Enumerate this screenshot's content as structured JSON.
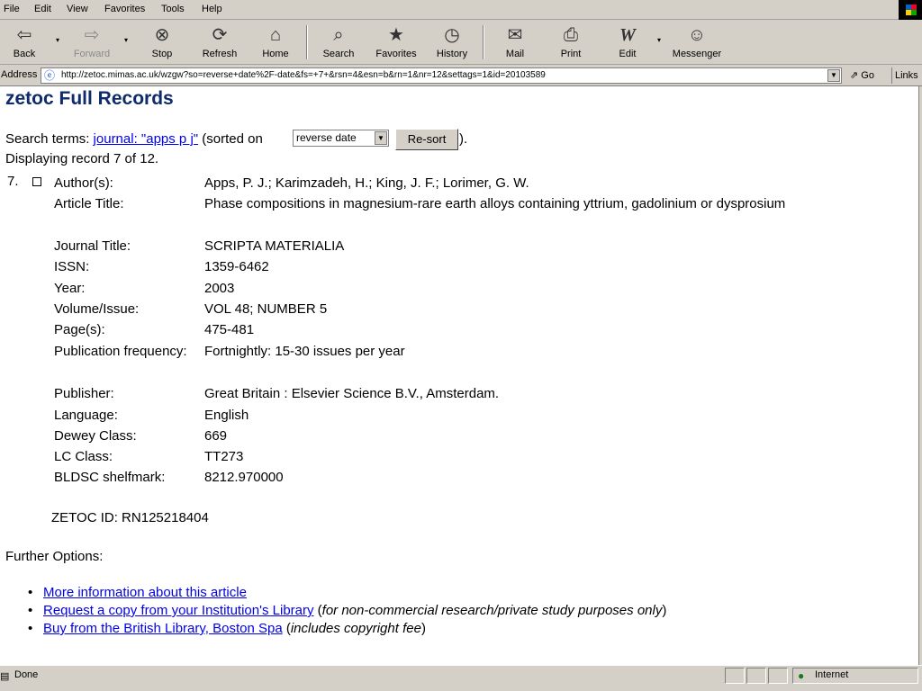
{
  "menu": [
    "File",
    "Edit",
    "View",
    "Favorites",
    "Tools",
    "Help"
  ],
  "toolbar": {
    "back": "Back",
    "forward": "Forward",
    "stop": "Stop",
    "refresh": "Refresh",
    "home": "Home",
    "search": "Search",
    "favorites": "Favorites",
    "history": "History",
    "mail": "Mail",
    "print": "Print",
    "edit": "Edit",
    "messenger": "Messenger"
  },
  "address": {
    "label": "Address",
    "url": "http://zetoc.mimas.ac.uk/wzgw?so=reverse+date%2F-date&fs=+7+&rsn=4&esn=b&rn=1&nr=12&settags=1&id=20103589",
    "go": "Go",
    "links": "Links"
  },
  "page": {
    "title": "zetoc Full Records",
    "search_prefix": "Search terms:",
    "search_link": "journal: \"apps p j\"",
    "sorted_on": "(sorted on",
    "sort_value": "reverse date",
    "resort": "Re-sort",
    "after_sort": ").",
    "displaying": "Displaying record 7 of 12."
  },
  "record": {
    "number": "7.",
    "fields": [
      {
        "label": "Author(s):",
        "value": "Apps, P. J.; Karimzadeh, H.; King, J. F.; Lorimer, G. W."
      },
      {
        "label": "Article Title:",
        "value": "Phase compositions in magnesium-rare earth alloys containing yttrium, gadolinium or dysprosium"
      },
      {
        "label": "Journal Title:",
        "value": "SCRIPTA MATERIALIA"
      },
      {
        "label": "ISSN:",
        "value": "1359-6462"
      },
      {
        "label": "Year:",
        "value": "2003"
      },
      {
        "label": "Volume/Issue:",
        "value": "VOL 48; NUMBER 5"
      },
      {
        "label": "Page(s):",
        "value": "475-481"
      },
      {
        "label": "Publication frequency:",
        "value": "Fortnightly: 15-30 issues per year"
      },
      {
        "label": "Publisher:",
        "value": "Great Britain : Elsevier Science B.V., Amsterdam."
      },
      {
        "label": "Language:",
        "value": "English"
      },
      {
        "label": "Dewey Class:",
        "value": "669"
      },
      {
        "label": "LC Class:",
        "value": "TT273"
      },
      {
        "label": "BLDSC shelfmark:",
        "value": "8212.970000"
      }
    ],
    "zetoc_id": "ZETOC ID: RN125218404"
  },
  "further_options": {
    "heading": "Further Options:",
    "items": [
      {
        "link": "More information about this article",
        "note_before": "",
        "note": "",
        "note_after": ""
      },
      {
        "link": "Request a copy from your Institution's Library",
        "note_before": "(",
        "note": "for non-commercial research/private study purposes only",
        "note_after": ")"
      },
      {
        "link": "Buy from the British Library, Boston Spa",
        "note_before": "(",
        "note": "includes copyright fee",
        "note_after": ")"
      }
    ]
  },
  "status": {
    "text": "Done",
    "zone": "Internet"
  },
  "icons": {
    "back": "back-arrow-icon",
    "forward": "forward-arrow-icon",
    "stop": "stop-icon",
    "refresh": "refresh-icon",
    "home": "home-icon",
    "search": "search-icon",
    "favorites": "favorites-icon",
    "history": "history-icon",
    "mail": "mail-icon",
    "print": "print-icon",
    "edit": "edit-icon",
    "messenger": "messenger-icon",
    "page": "ie-page-icon",
    "zone": "globe-icon"
  },
  "colors": {
    "title": "#0f2b6b",
    "link": "#0000ee",
    "chrome": "#d4d0c8"
  }
}
